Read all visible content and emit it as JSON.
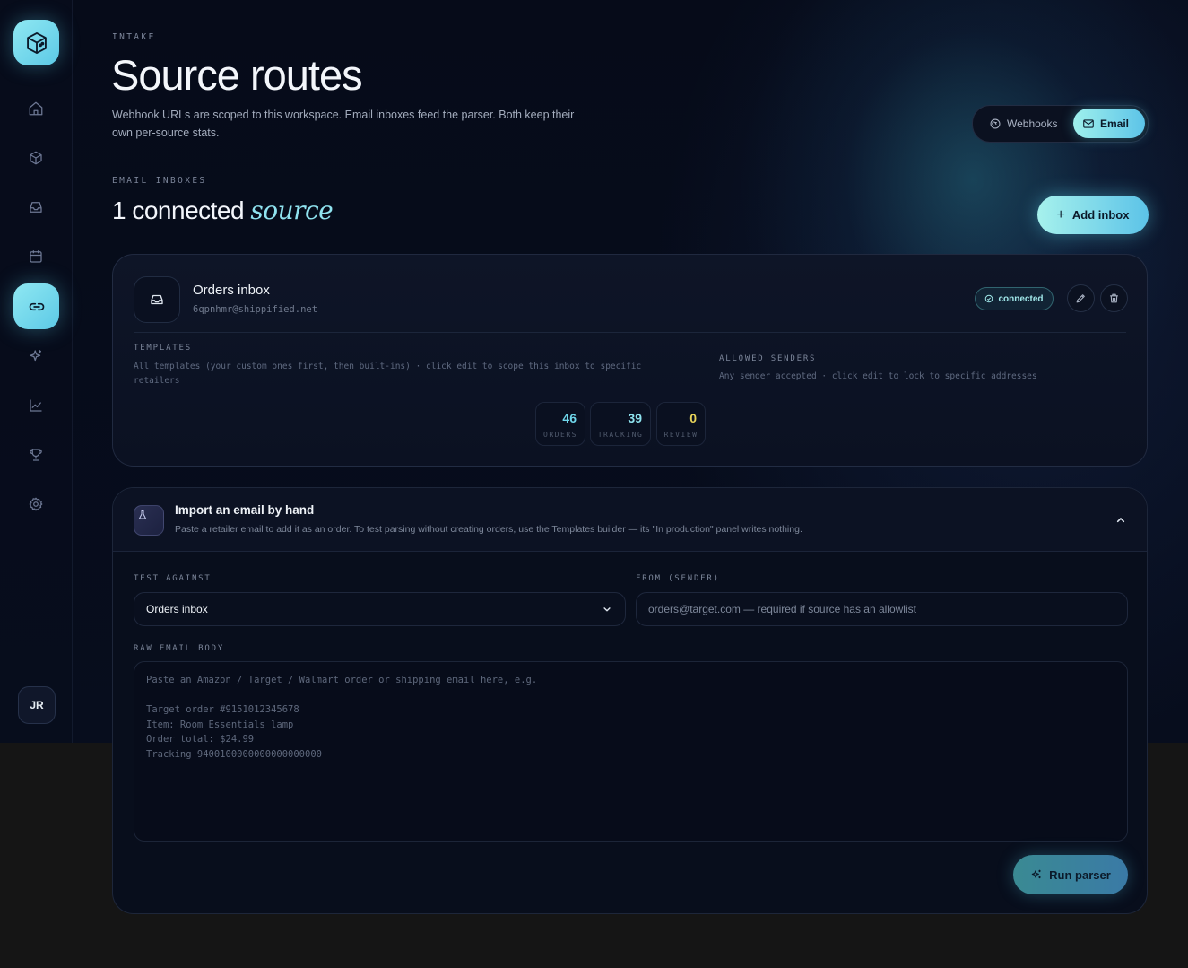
{
  "colors": {
    "accent": "#6fd6ea",
    "orders": "#6fd6ea",
    "tracking": "#8fe3ef",
    "review": "#e8d45a"
  },
  "sidebar": {
    "items": [
      {
        "name": "home",
        "icon": "home-icon",
        "active": false
      },
      {
        "name": "packages",
        "icon": "box-icon",
        "active": false
      },
      {
        "name": "inbox",
        "icon": "inbox-icon",
        "active": false
      },
      {
        "name": "calendar",
        "icon": "calendar-icon",
        "active": false
      },
      {
        "name": "sources",
        "icon": "link-icon",
        "active": true
      },
      {
        "name": "sparkles",
        "icon": "sparkles-icon",
        "active": false
      },
      {
        "name": "analytics",
        "icon": "chart-icon",
        "active": false
      },
      {
        "name": "trophy",
        "icon": "trophy-icon",
        "active": false
      },
      {
        "name": "settings",
        "icon": "gear-icon",
        "active": false
      }
    ],
    "avatar": "JR"
  },
  "header": {
    "eyebrow": "INTAKE",
    "title": "Source routes",
    "description": "Webhook URLs are scoped to this workspace. Email inboxes feed the parser. Both keep their own per-source stats.",
    "toggle": {
      "webhooks": "Webhooks",
      "email": "Email",
      "selected": "Email"
    }
  },
  "section": {
    "eyebrow": "EMAIL INBOXES",
    "title_main": "1 connected",
    "title_accent": "source",
    "add_button": "Add inbox"
  },
  "inbox": {
    "name": "Orders inbox",
    "email": "6qpnhmr@shippified.net",
    "status": "connected",
    "templates_label": "TEMPLATES",
    "templates_text": "All templates (your custom ones first, then built-ins) · click edit to scope this inbox to specific retailers",
    "senders_label": "ALLOWED SENDERS",
    "senders_text": "Any sender accepted · click edit to lock to specific addresses",
    "stats": [
      {
        "value": "46",
        "label": "ORDERS"
      },
      {
        "value": "39",
        "label": "TRACKING"
      },
      {
        "value": "0",
        "label": "REVIEW"
      }
    ]
  },
  "import": {
    "title": "Import an email by hand",
    "description": "Paste a retailer email to add it as an order. To test parsing without creating orders, use the Templates builder — its \"In production\" panel writes nothing.",
    "test_against_label": "TEST AGAINST",
    "test_against_value": "Orders inbox",
    "from_label": "FROM (SENDER)",
    "from_placeholder": "orders@target.com — required if source has an allowlist",
    "body_label": "RAW EMAIL BODY",
    "body_placeholder": "Paste an Amazon / Target / Walmart order or shipping email here, e.g.\n\nTarget order #9151012345678\nItem: Room Essentials lamp\nOrder total: $24.99\nTracking 9400100000000000000000",
    "run_button": "Run parser"
  }
}
